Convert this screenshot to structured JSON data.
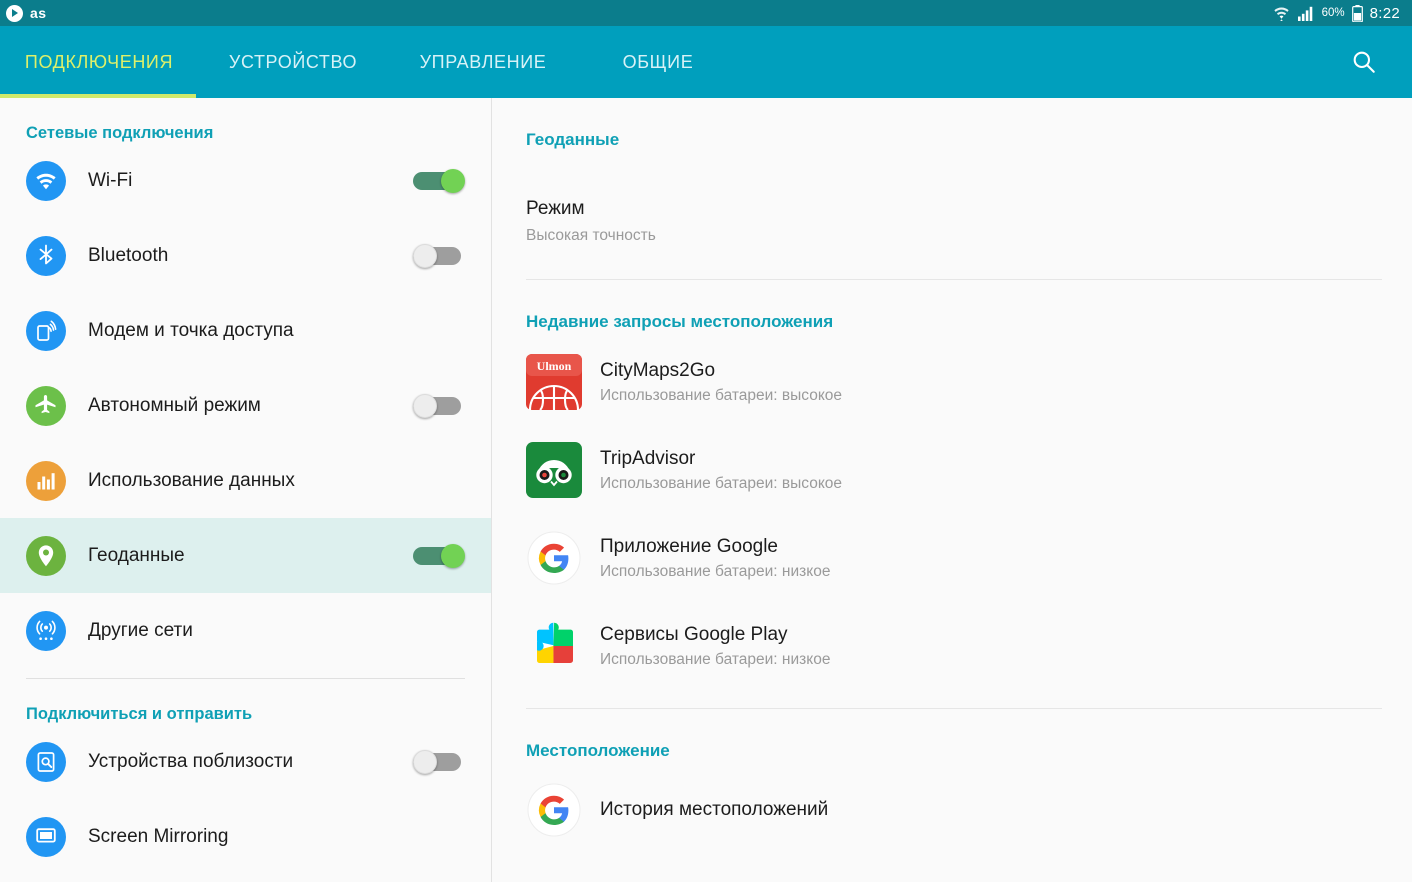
{
  "statusbar": {
    "brand": "as",
    "play_icon": "play-circle-icon",
    "wifi_icon": "wifi-icon",
    "signal_icon": "cellular-signal-icon",
    "battery_percent": "60%",
    "battery_icon": "battery-icon",
    "clock": "8:22",
    "bg_color": "#0b7d8c"
  },
  "tabs": {
    "items": [
      {
        "label": "ПОДКЛЮЧЕНИЯ",
        "active": true
      },
      {
        "label": "УСТРОЙСТВО",
        "active": false
      },
      {
        "label": "УПРАВЛЕНИЕ",
        "active": false
      },
      {
        "label": "ОБЩИЕ",
        "active": false
      }
    ],
    "search_icon": "search-icon",
    "bg_color": "#009fbd",
    "active_color": "#ddf06a",
    "underline_color": "#cfe96a"
  },
  "sidebar": {
    "group1_title": "Сетевые подключения",
    "group2_title": "Подключиться и отправить",
    "items": [
      {
        "label": "Wi-Fi",
        "icon": "wifi-icon",
        "icon_color": "#2196f3",
        "toggle": "on"
      },
      {
        "label": "Bluetooth",
        "icon": "bluetooth-icon",
        "icon_color": "#2196f3",
        "toggle": "off"
      },
      {
        "label": "Модем и точка доступа",
        "icon": "tethering-hotspot-icon",
        "icon_color": "#2196f3",
        "toggle": "none"
      },
      {
        "label": "Автономный режим",
        "icon": "airplane-icon",
        "icon_color": "#6cc04a",
        "toggle": "off"
      },
      {
        "label": "Использование данных",
        "icon": "data-usage-chart-icon",
        "icon_color": "#eda03a",
        "toggle": "none"
      },
      {
        "label": "Геоданные",
        "icon": "location-pin-icon",
        "icon_color": "#6cb33f",
        "toggle": "on",
        "selected": true
      },
      {
        "label": "Другие сети",
        "icon": "broadcast-tower-icon",
        "icon_color": "#2196f3",
        "toggle": "none"
      }
    ],
    "items2": [
      {
        "label": "Устройства поблизости",
        "icon": "nearby-devices-icon",
        "icon_color": "#2196f3",
        "toggle": "off"
      },
      {
        "label": "Screen Mirroring",
        "icon": "screen-mirroring-icon",
        "icon_color": "#2196f3",
        "toggle": "none"
      }
    ],
    "selected_bg": "#ddf0ee"
  },
  "main": {
    "section_title": "Геоданные",
    "mode_title": "Режим",
    "mode_value": "Высокая точность",
    "recent_title": "Недавние запросы местоположения",
    "recent_apps": [
      {
        "name": "CityMaps2Go",
        "battery": "Использование батареи: высокое",
        "icon": "citymaps2go-ulmon-icon"
      },
      {
        "name": "TripAdvisor",
        "battery": "Использование батареи: высокое",
        "icon": "tripadvisor-owl-icon"
      },
      {
        "name": "Приложение Google",
        "battery": "Использование батареи: низкое",
        "icon": "google-g-icon"
      },
      {
        "name": "Сервисы Google Play",
        "battery": "Использование батареи: низкое",
        "icon": "google-play-services-icon"
      }
    ],
    "location_title": "Местоположение",
    "location_items": [
      {
        "label": "История местоположений",
        "icon": "google-g-icon"
      }
    ]
  }
}
